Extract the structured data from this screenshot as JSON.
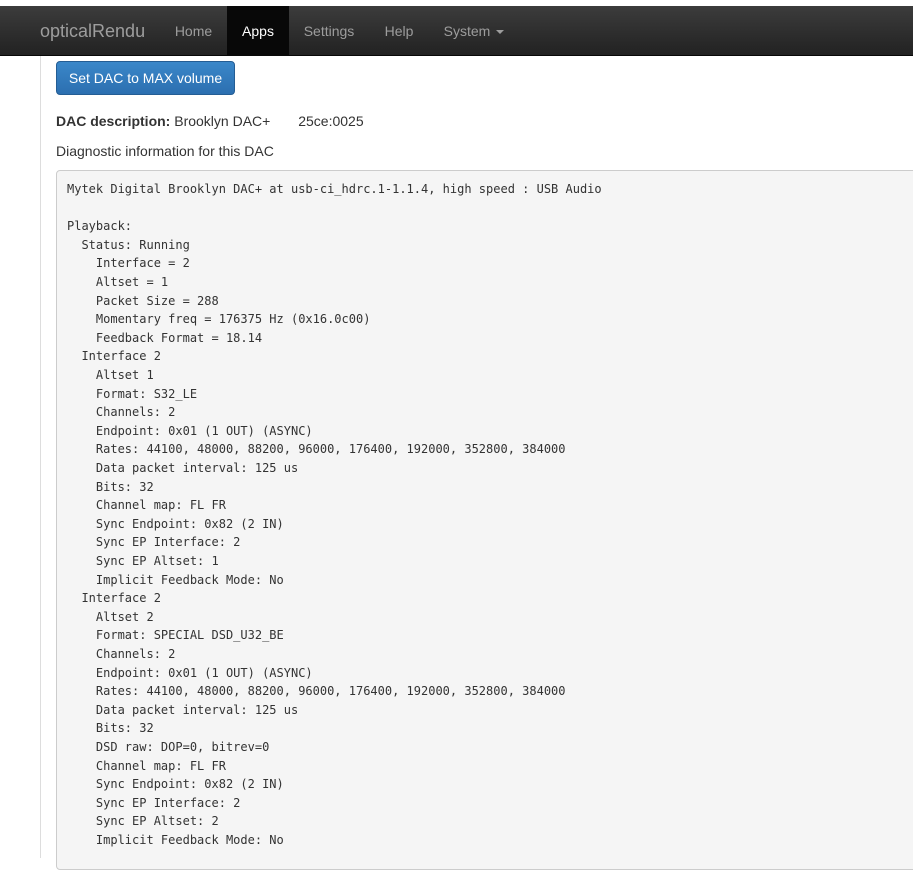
{
  "navbar": {
    "brand": "opticalRendu",
    "items": [
      {
        "label": "Home",
        "active": false
      },
      {
        "label": "Apps",
        "active": true
      },
      {
        "label": "Settings",
        "active": false
      },
      {
        "label": "Help",
        "active": false
      },
      {
        "label": "System",
        "active": false,
        "dropdown": true
      }
    ]
  },
  "main": {
    "max_volume_button": "Set DAC to MAX volume",
    "dac_description_label": "DAC description:",
    "dac_description_value": "Brooklyn DAC+",
    "dac_usb_id": "25ce:0025",
    "diagnostic_title": "Diagnostic information for this DAC",
    "diagnostic_lines": [
      "Mytek Digital Brooklyn DAC+ at usb-ci_hdrc.1-1.1.4, high speed : USB Audio",
      "",
      "Playback:",
      "  Status: Running",
      "    Interface = 2",
      "    Altset = 1",
      "    Packet Size = 288",
      "    Momentary freq = 176375 Hz (0x16.0c00)",
      "    Feedback Format = 18.14",
      "  Interface 2",
      "    Altset 1",
      "    Format: S32_LE",
      "    Channels: 2",
      "    Endpoint: 0x01 (1 OUT) (ASYNC)",
      "    Rates: 44100, 48000, 88200, 96000, 176400, 192000, 352800, 384000",
      "    Data packet interval: 125 us",
      "    Bits: 32",
      "    Channel map: FL FR",
      "    Sync Endpoint: 0x82 (2 IN)",
      "    Sync EP Interface: 2",
      "    Sync EP Altset: 1",
      "    Implicit Feedback Mode: No",
      "  Interface 2",
      "    Altset 2",
      "    Format: SPECIAL DSD_U32_BE",
      "    Channels: 2",
      "    Endpoint: 0x01 (1 OUT) (ASYNC)",
      "    Rates: 44100, 48000, 88200, 96000, 176400, 192000, 352800, 384000",
      "    Data packet interval: 125 us",
      "    Bits: 32",
      "    DSD raw: DOP=0, bitrev=0",
      "    Channel map: FL FR",
      "    Sync Endpoint: 0x82 (2 IN)",
      "    Sync EP Interface: 2",
      "    Sync EP Altset: 2",
      "    Implicit Feedback Mode: No"
    ]
  },
  "colors": {
    "navbar_bg": "#222222",
    "nav_text": "#9d9d9d",
    "nav_active_bg": "#080808",
    "primary_button": "#337ab7",
    "pre_bg": "#f5f5f5"
  }
}
